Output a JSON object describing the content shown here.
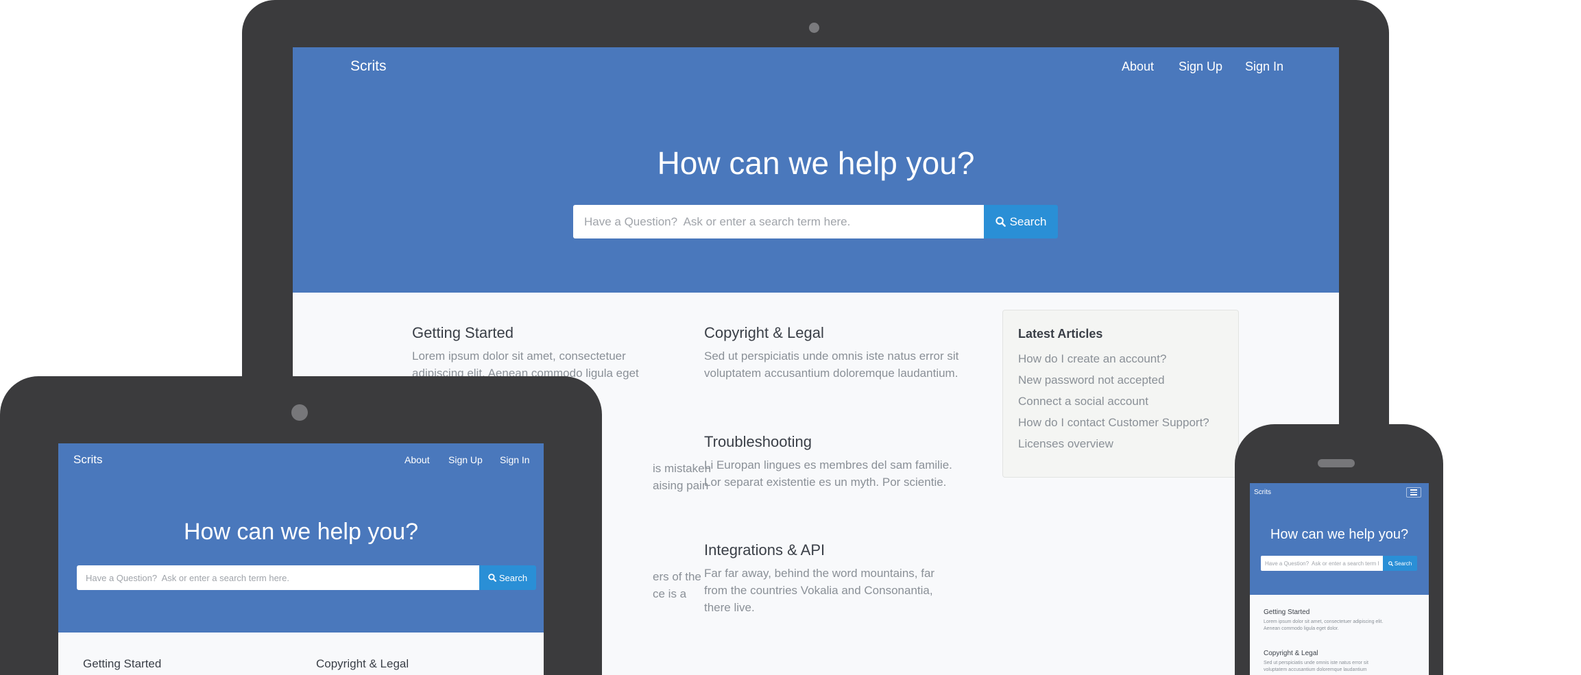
{
  "brand": "Scrits",
  "nav": {
    "about": "About",
    "signup": "Sign Up",
    "signin": "Sign In"
  },
  "hero": {
    "title": "How can we help you?",
    "search_placeholder": "Have a Question?  Ask or enter a search term here.",
    "search_button": "Search"
  },
  "sections": [
    {
      "title": "Getting Started",
      "text": "Lorem ipsum dolor sit amet, consectetuer adipiscing elit. Aenean commodo ligula eget dolor."
    },
    {
      "title": "Copyright & Legal",
      "text": "Sed ut perspiciatis unde omnis iste natus error sit voluptatem accusantium doloremque laudantium."
    },
    {
      "title": "Troubleshooting",
      "text": "Li Europan lingues es membres del sam familie. Lor separat existentie es un myth. Por scientie."
    },
    {
      "title": "Integrations & API",
      "text": "Far far away, behind the word mountains, far from the countries Vokalia and Consonantia, there live."
    }
  ],
  "left_column_fragments": {
    "frag1_line1": "is mistaken",
    "frag1_line2": "aising pain",
    "frag2_line1": "ers of the",
    "frag2_line2": "ce is a"
  },
  "latest_articles": {
    "title": "Latest Articles",
    "items": [
      "How do I create an account?",
      "New password not accepted",
      "Connect a social account",
      "How do I contact Customer Support?",
      "Licenses overview"
    ]
  },
  "phone": {
    "getting_started_text_line1": "Lorem ipsum dolor sit amet, consectetuer adipiscing elit.",
    "getting_started_text_line2": "Aenean commodo ligula eget dolor.",
    "copyright_text_line1": "Sed ut perspiciatis unde omnis iste natus error sit",
    "copyright_text_line2": "voluptatem accusantium doloremque laudantium"
  },
  "colors": {
    "hero": "#4a78bc",
    "search_button": "#2a8fd6",
    "device_frame": "#3b3b3d",
    "page_bg": "#f8f9fb"
  },
  "icons": [
    "search-icon",
    "hamburger-menu-icon"
  ]
}
